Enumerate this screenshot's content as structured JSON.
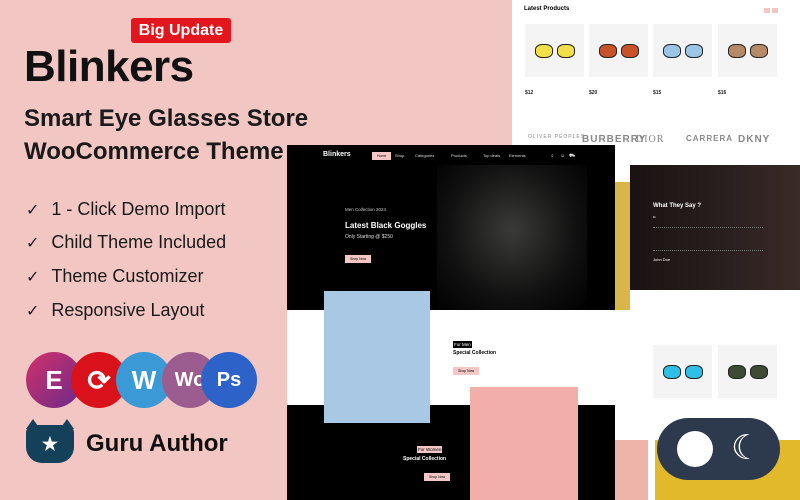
{
  "hero": {
    "badge": "Big Update",
    "title": "Blinkers",
    "subtitle_1": "Smart Eye Glasses Store",
    "subtitle_2": "WooCommerce Theme"
  },
  "features": [
    "1 - Click Demo Import",
    "Child Theme Included",
    "Theme Customizer",
    "Responsive Layout"
  ],
  "tech_icons": [
    {
      "name": "elementor-icon",
      "glyph": "E",
      "color": "#92003b"
    },
    {
      "name": "sync-icon",
      "glyph": "⟳",
      "color": "#d8111a"
    },
    {
      "name": "wordpress-icon",
      "glyph": "W",
      "color": "#3b9ad6"
    },
    {
      "name": "woocommerce-icon",
      "glyph": "Wo",
      "color": "#9b5c8f"
    },
    {
      "name": "photoshop-icon",
      "glyph": "Ps",
      "color": "#2d62c9"
    }
  ],
  "author": {
    "label": "Guru Author"
  },
  "latest": {
    "title": "Latest Products",
    "products": [
      {
        "lens": "#f1e04a",
        "price": "$12"
      },
      {
        "lens": "#c8532a",
        "price": "$20"
      },
      {
        "lens": "#9cc6e6",
        "price": "$15"
      },
      {
        "lens": "#8a5a36",
        "price": "$16"
      }
    ],
    "brands": [
      "OLIVER PEOPLES",
      "BURBERRY",
      "DIOR",
      "CARRERA",
      "DKNY"
    ]
  },
  "site": {
    "logo": "Blinkers",
    "nav": [
      "Home",
      "Shop",
      "Categories",
      "Products",
      "Top deals",
      "Elements"
    ],
    "hero_kicker": "Men Collection 2024",
    "hero_title": "Latest Black Goggles",
    "hero_price": "Only Starting  @ $250",
    "shop_now": "Shop Now",
    "men_tag": "For Men",
    "men_title": "Special Collection",
    "women_tag": "For Women",
    "women_title": "Special Collection"
  },
  "testimonial": {
    "title": "What They Say ?",
    "name": "John Doe"
  },
  "colors": {
    "background": "#f1c6c3",
    "accent": "#e3161d",
    "toggle": "#2d3a4d"
  }
}
